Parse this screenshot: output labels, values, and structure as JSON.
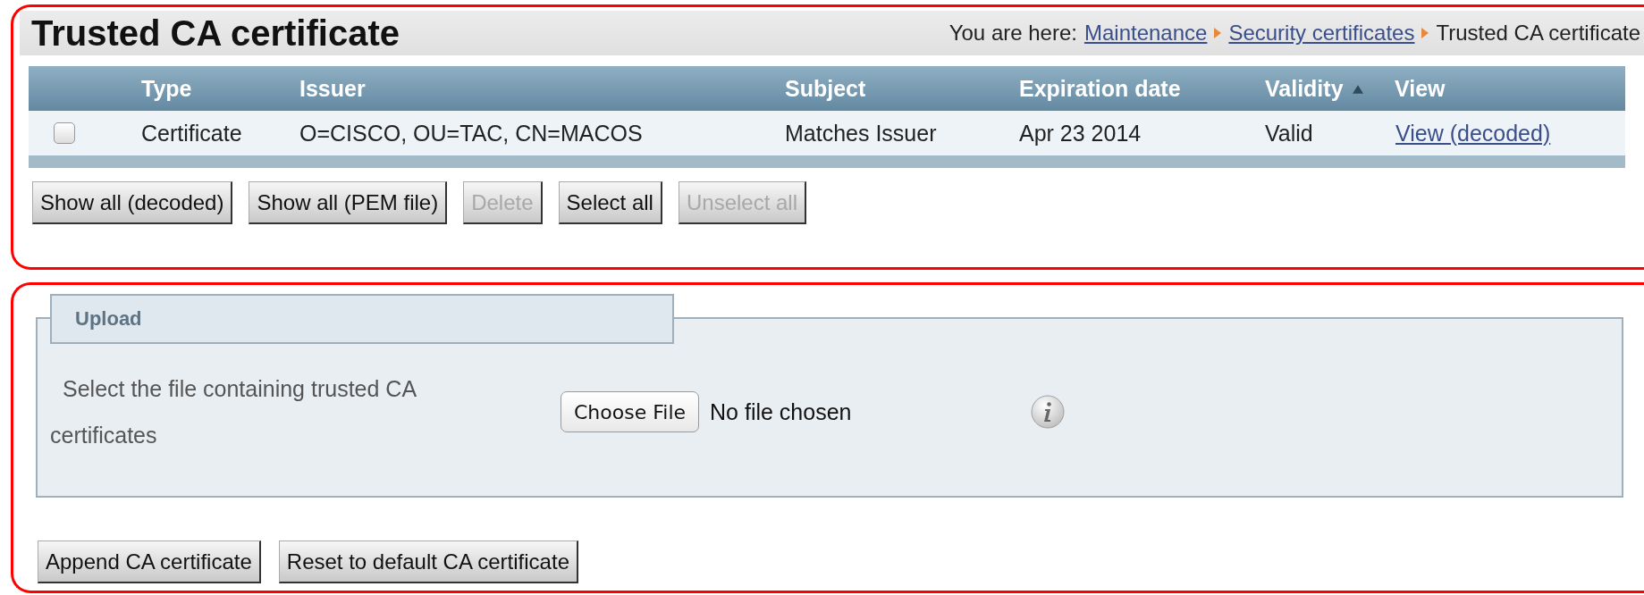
{
  "page": {
    "title": "Trusted CA certificate",
    "breadcrumb": {
      "label": "You are here:",
      "links": [
        "Maintenance",
        "Security certificates"
      ],
      "current": "Trusted CA certificate"
    }
  },
  "table": {
    "columns": [
      {
        "label": "Type",
        "sorted": false
      },
      {
        "label": "Issuer",
        "sorted": false
      },
      {
        "label": "Subject",
        "sorted": false
      },
      {
        "label": "Expiration date",
        "sorted": false
      },
      {
        "label": "Validity",
        "sorted": true
      },
      {
        "label": "View",
        "sorted": false
      }
    ],
    "rows": [
      {
        "checked": false,
        "cells": [
          "Certificate",
          "O=CISCO, OU=TAC, CN=MACOS",
          "Matches Issuer",
          "Apr 23 2014",
          "Valid"
        ],
        "link": "View (decoded)"
      }
    ]
  },
  "actions": [
    {
      "label": "Show all (decoded)",
      "disabled": false
    },
    {
      "label": "Show all (PEM file)",
      "disabled": false
    },
    {
      "label": "Delete",
      "disabled": true
    },
    {
      "label": "Select all",
      "disabled": false
    },
    {
      "label": "Unselect all",
      "disabled": true
    }
  ],
  "upload": {
    "legend": "Upload",
    "label": "Select the file containing trusted CA certificates",
    "file_button": "Choose File",
    "file_status": "No file chosen"
  },
  "upload_actions": [
    {
      "label": "Append CA certificate",
      "disabled": false
    },
    {
      "label": "Reset to default CA certificate",
      "disabled": false
    }
  ]
}
